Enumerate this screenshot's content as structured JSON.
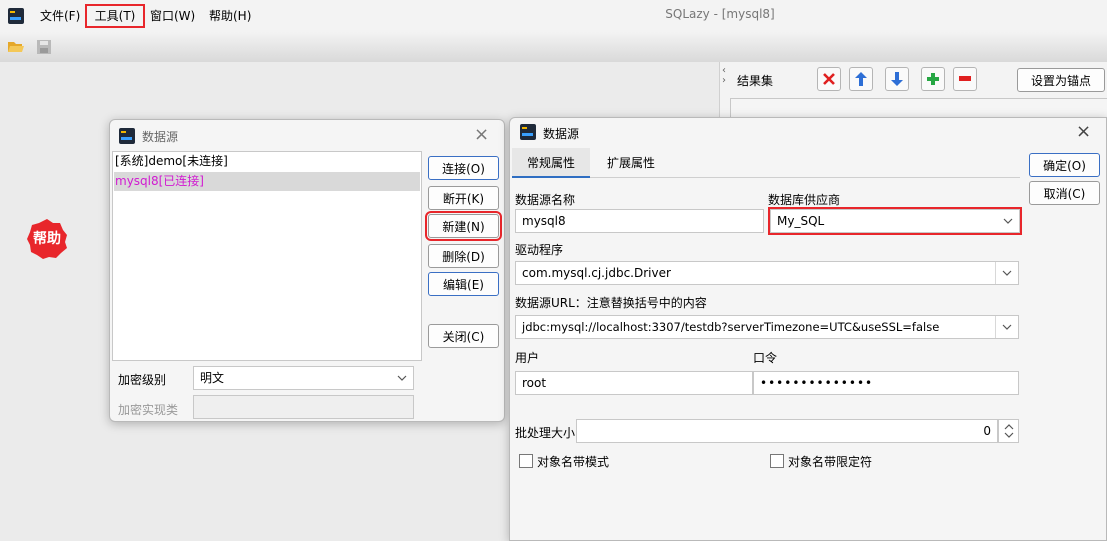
{
  "app": {
    "window_title": "SQLazy - [mysql8]",
    "menus": [
      "文件(F)",
      "工具(T)",
      "窗口(W)",
      "帮助(H)"
    ]
  },
  "help_badge": {
    "label": "帮助",
    "color": "#e8262b"
  },
  "result_panel": {
    "title": "结果集",
    "anchor_button": "设置为锚点"
  },
  "datasource_list_dialog": {
    "title": "数据源",
    "items": [
      {
        "label": "[系统]demo[未连接]",
        "color": "#000000",
        "selected": false
      },
      {
        "label": "mysql8[已连接]",
        "color": "#d11ad1",
        "selected": true
      }
    ],
    "buttons": {
      "connect": "连接(O)",
      "disconnect": "断开(K)",
      "new": "新建(N)",
      "delete": "删除(D)",
      "edit": "编辑(E)",
      "close": "关闭(C)"
    },
    "encryption_level_label": "加密级别",
    "encryption_level_value": "明文",
    "encryption_class_label": "加密实现类",
    "encryption_class_value": ""
  },
  "datasource_edit_dialog": {
    "title": "数据源",
    "tabs": [
      "常规属性",
      "扩展属性"
    ],
    "ok_button": "确定(O)",
    "cancel_button": "取消(C)",
    "fields": {
      "name_label": "数据源名称",
      "name_value": "mysql8",
      "vendor_label": "数据库供应商",
      "vendor_value": "My_SQL",
      "driver_label": "驱动程序",
      "driver_value": "com.mysql.cj.jdbc.Driver",
      "url_label": "数据源URL：注意替换括号中的内容",
      "url_value": "jdbc:mysql://localhost:3307/testdb?serverTimezone=UTC&useSSL=false",
      "user_label": "用户",
      "user_value": "root",
      "password_label": "口令",
      "password_value": "••••••••••••••",
      "batch_label": "批处理大小",
      "batch_value": "0",
      "quote_mode_label": "对象名带模式",
      "quote_delim_label": "对象名带限定符"
    }
  },
  "colors": {
    "accent_red": "#e8262b",
    "accent_blue": "#3a6fc4"
  }
}
